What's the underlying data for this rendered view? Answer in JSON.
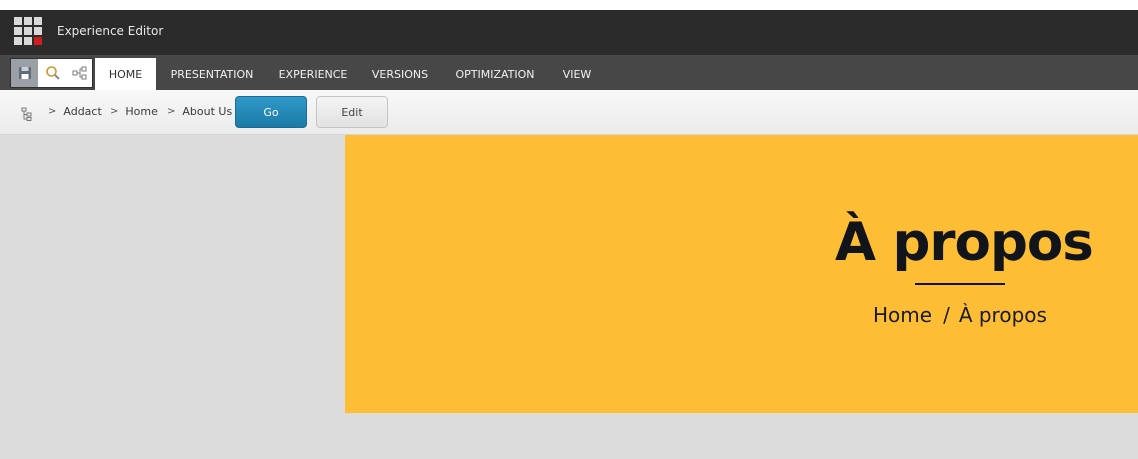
{
  "app": {
    "title": "Experience Editor"
  },
  "ribbon": {
    "quick_access": [
      "save-icon",
      "search-icon",
      "navigation-tree-icon"
    ],
    "tabs": [
      {
        "label": "HOME",
        "active": true
      },
      {
        "label": "PRESENTATION",
        "active": false
      },
      {
        "label": "EXPERIENCE",
        "active": false
      },
      {
        "label": "VERSIONS",
        "active": false
      },
      {
        "label": "OPTIMIZATION",
        "active": false
      },
      {
        "label": "VIEW",
        "active": false
      }
    ]
  },
  "breadcrumb": {
    "items": [
      "Addact",
      "Home",
      "About Us"
    ],
    "go_label": "Go",
    "edit_label": "Edit"
  },
  "hero": {
    "title": "À propos",
    "crumb_home": "Home",
    "crumb_separator": "/",
    "crumb_current": "À propos",
    "background_color": "#fdbd34"
  },
  "colors": {
    "titlebar": "#2b2b2b",
    "ribbon": "#474747",
    "go_button": "#1c7aa6",
    "page_background": "#dcdcdc"
  }
}
